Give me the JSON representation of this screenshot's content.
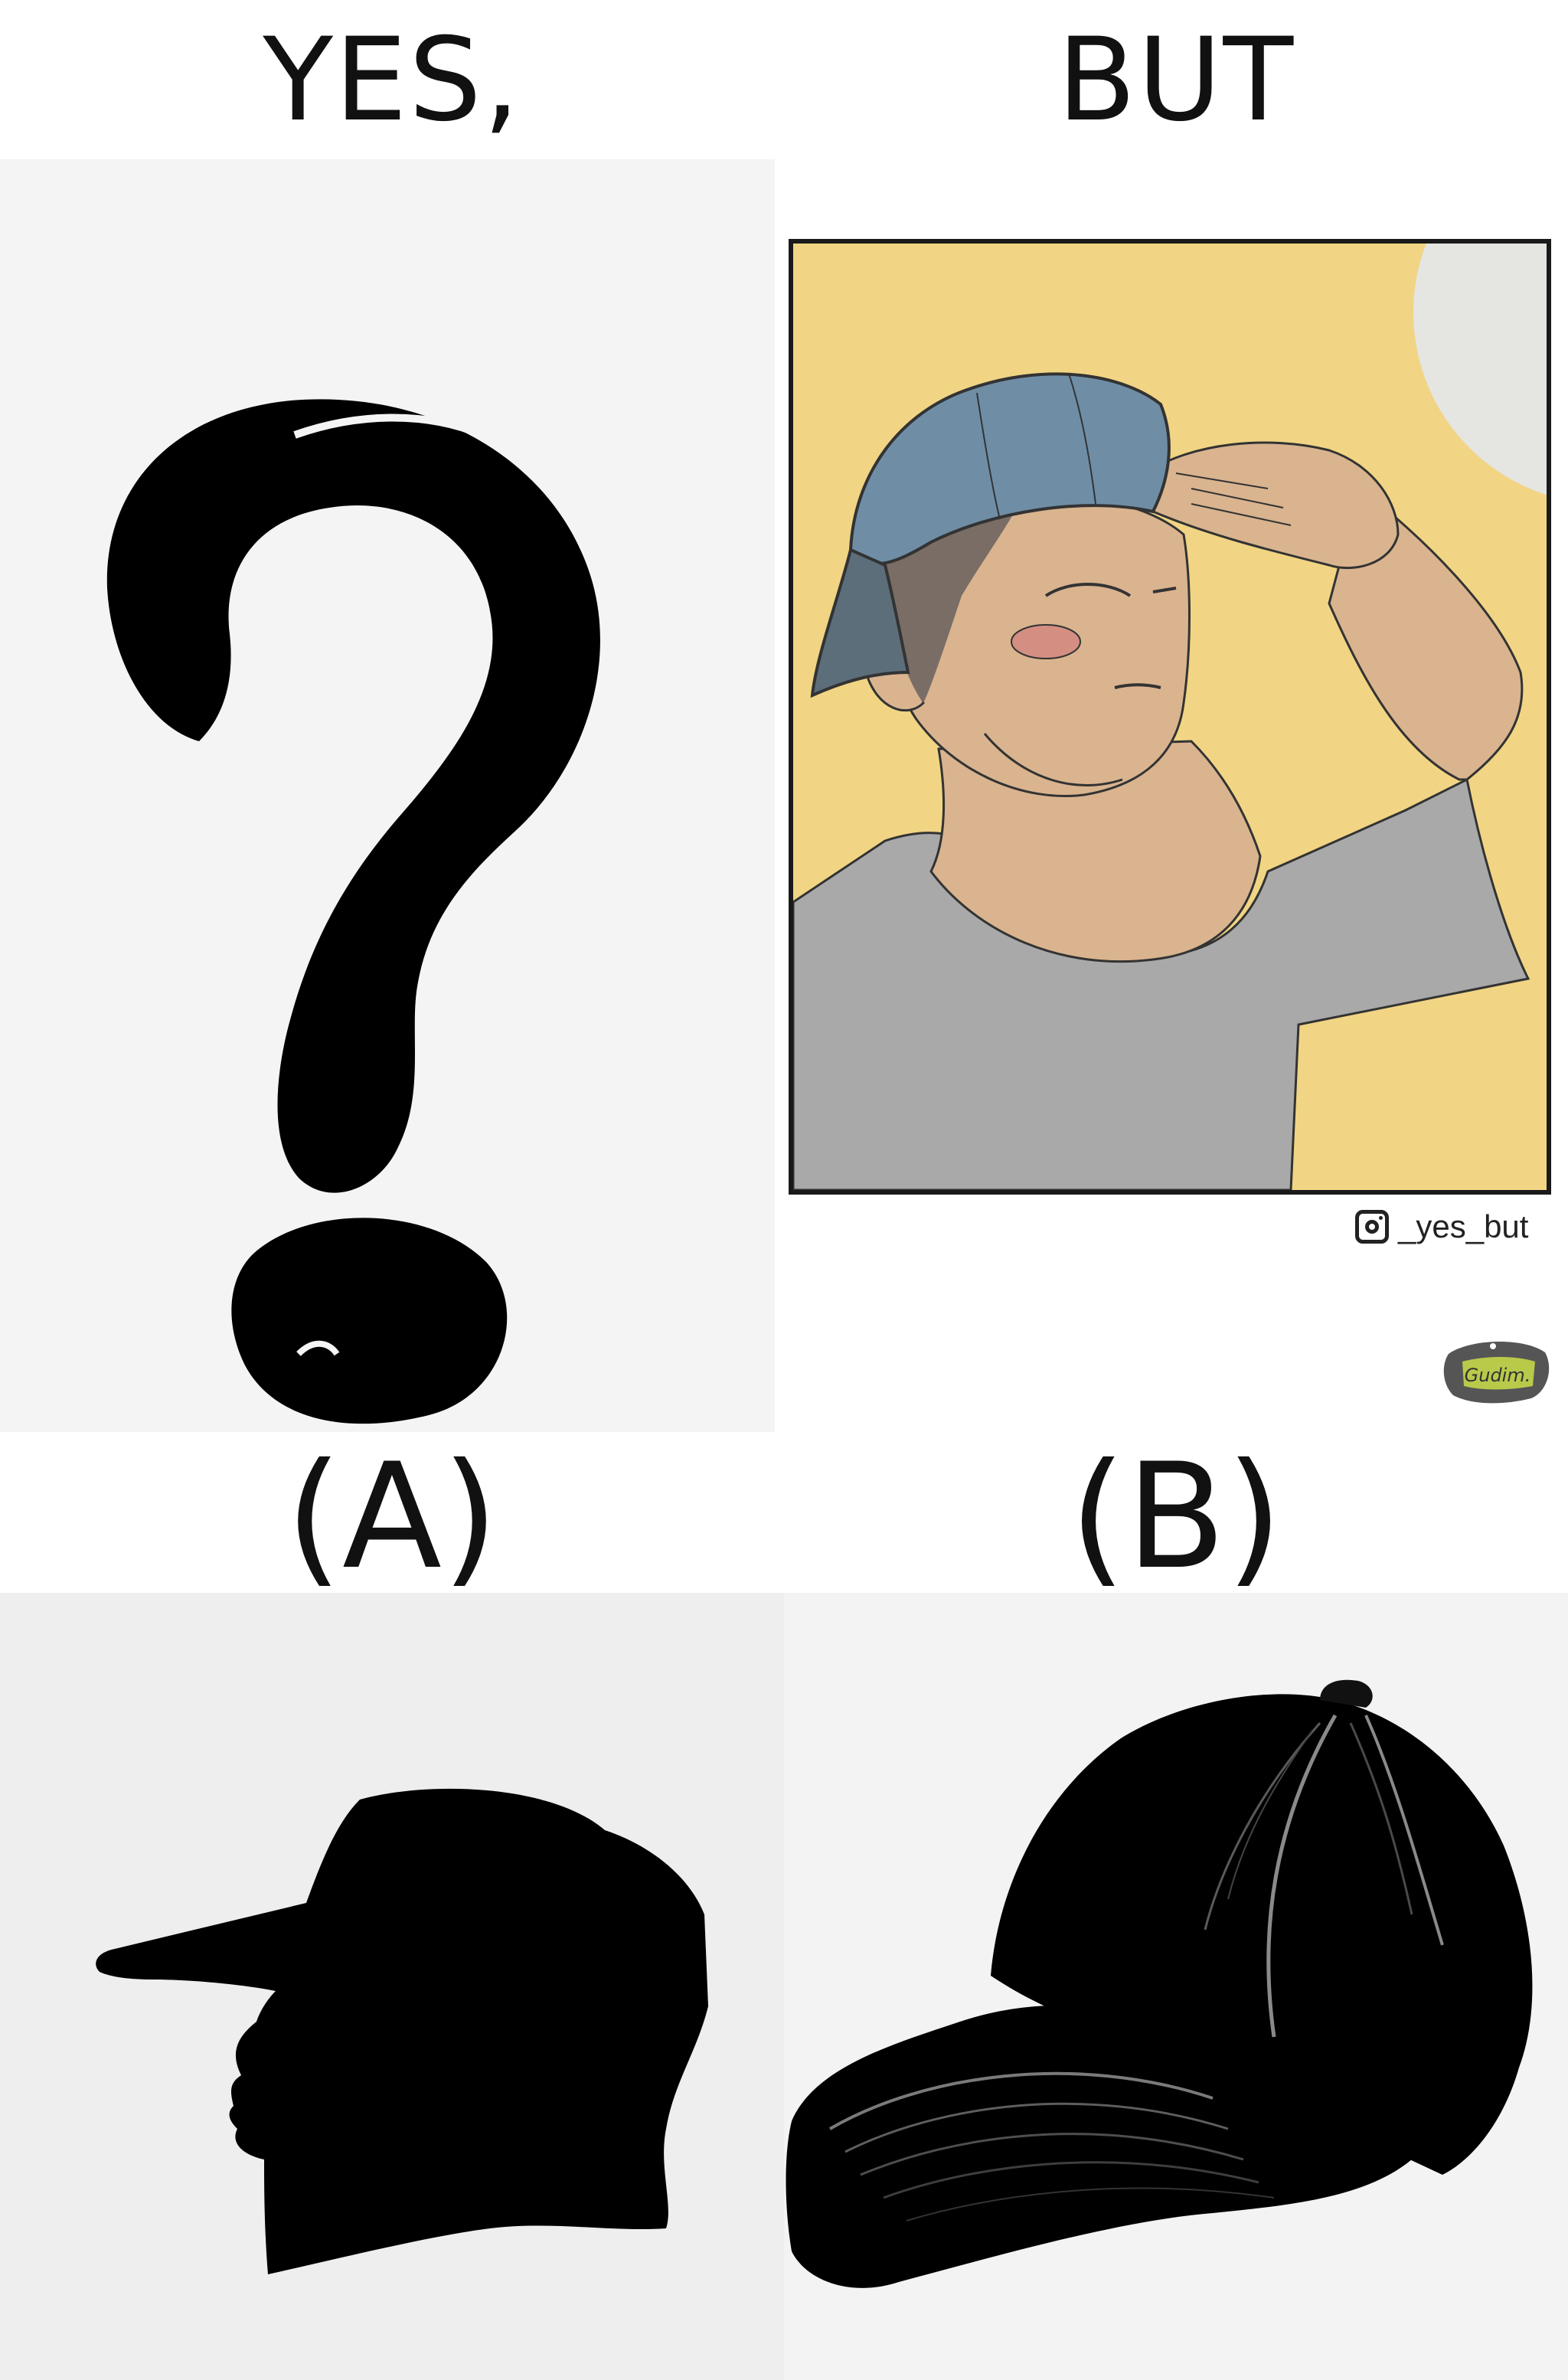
{
  "header": {
    "yes": "YES,",
    "but": "BUT"
  },
  "labels": {
    "a": "(A)",
    "b": "(B)"
  },
  "credit": {
    "icon": "instagram-icon",
    "handle": "_yes_but"
  },
  "logo": {
    "text": "Gudim."
  },
  "colors": {
    "comic_background": "#f1d584",
    "cap_blue": "#6f8ea6",
    "shirt_gray": "#a9a9a9",
    "skin": "#d9b48f",
    "silhouette_black": "#000000"
  }
}
